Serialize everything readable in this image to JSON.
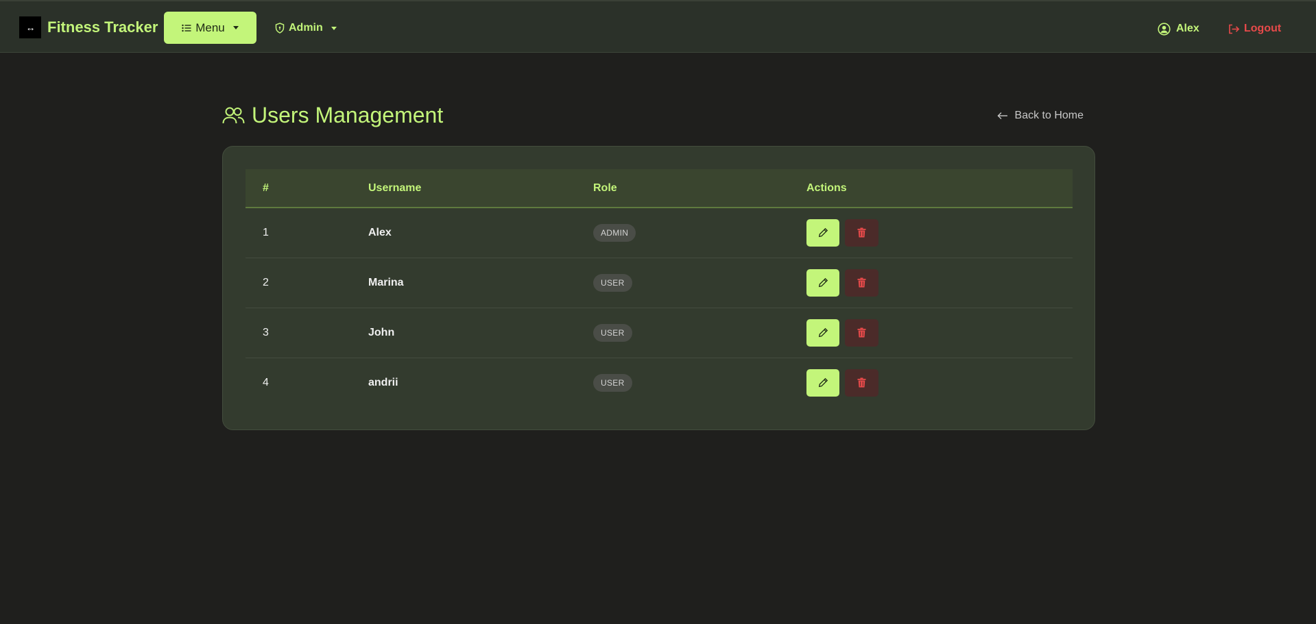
{
  "navbar": {
    "brand_logo": "↔",
    "brand_name": "Fitness Tracker",
    "menu_label": "Menu",
    "admin_label": "Admin",
    "user_name": "Alex",
    "logout_label": "Logout"
  },
  "page": {
    "title": "Users Management",
    "back_label": "Back to Home"
  },
  "table": {
    "headers": {
      "num": "#",
      "username": "Username",
      "role": "Role",
      "actions": "Actions"
    },
    "rows": [
      {
        "num": "1",
        "username": "Alex",
        "role": "ADMIN"
      },
      {
        "num": "2",
        "username": "Marina",
        "role": "USER"
      },
      {
        "num": "3",
        "username": "John",
        "role": "USER"
      },
      {
        "num": "4",
        "username": "andrii",
        "role": "USER"
      }
    ]
  },
  "colors": {
    "accent": "#c3f57a",
    "danger": "#e84a4a",
    "background": "#1f1f1d",
    "navbar": "#2b3129",
    "card": "#333b2e"
  },
  "icons": {
    "brand": "dumbbell-icon",
    "menu": "list-icon",
    "admin": "shield-icon",
    "user": "user-circle-icon",
    "logout": "logout-icon",
    "title": "users-icon",
    "back": "arrow-left-icon",
    "edit": "pencil-icon",
    "delete": "trash-icon"
  }
}
